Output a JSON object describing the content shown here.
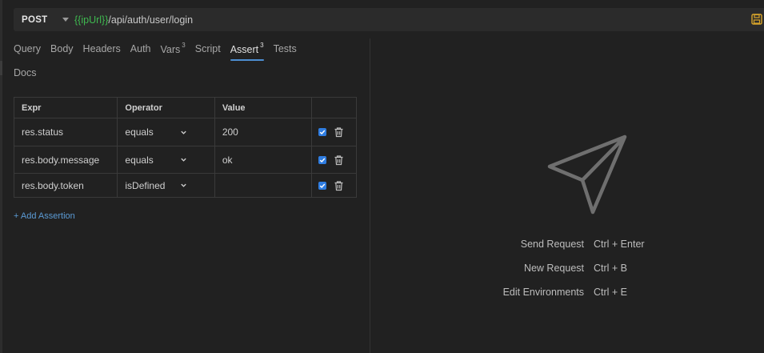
{
  "request": {
    "method": "POST",
    "url_var": "{{ipUrl}}",
    "url_path": "/api/auth/user/login"
  },
  "tabs": [
    {
      "label": "Query",
      "badge": ""
    },
    {
      "label": "Body",
      "badge": ""
    },
    {
      "label": "Headers",
      "badge": ""
    },
    {
      "label": "Auth",
      "badge": ""
    },
    {
      "label": "Vars",
      "badge": "3"
    },
    {
      "label": "Script",
      "badge": ""
    },
    {
      "label": "Assert",
      "badge": "3"
    },
    {
      "label": "Tests",
      "badge": ""
    },
    {
      "label": "Docs",
      "badge": ""
    }
  ],
  "active_tab": "Assert",
  "assertions": {
    "columns": [
      "Expr",
      "Operator",
      "Value"
    ],
    "rows": [
      {
        "expr": "res.status",
        "operator": "equals",
        "value": "200",
        "enabled": true
      },
      {
        "expr": "res.body.message",
        "operator": "equals",
        "value": "ok",
        "enabled": true
      },
      {
        "expr": "res.body.token",
        "operator": "isDefined",
        "value": "",
        "enabled": true
      }
    ],
    "add_label": "+ Add Assertion"
  },
  "placeholder": {
    "shortcuts": [
      {
        "label": "Send Request",
        "keys": "Ctrl + Enter"
      },
      {
        "label": "New Request",
        "keys": "Ctrl + B"
      },
      {
        "label": "Edit Environments",
        "keys": "Ctrl + E"
      }
    ]
  },
  "colors": {
    "accent": "#4d8ed1",
    "url_variable": "#3fb950",
    "checkbox": "#2f7de1",
    "save_icon": "#d9a52b"
  },
  "icons": {
    "save": "save-icon",
    "send": "paper-plane-icon",
    "delete": "trash-icon",
    "dropdown": "chevron-down-icon"
  }
}
